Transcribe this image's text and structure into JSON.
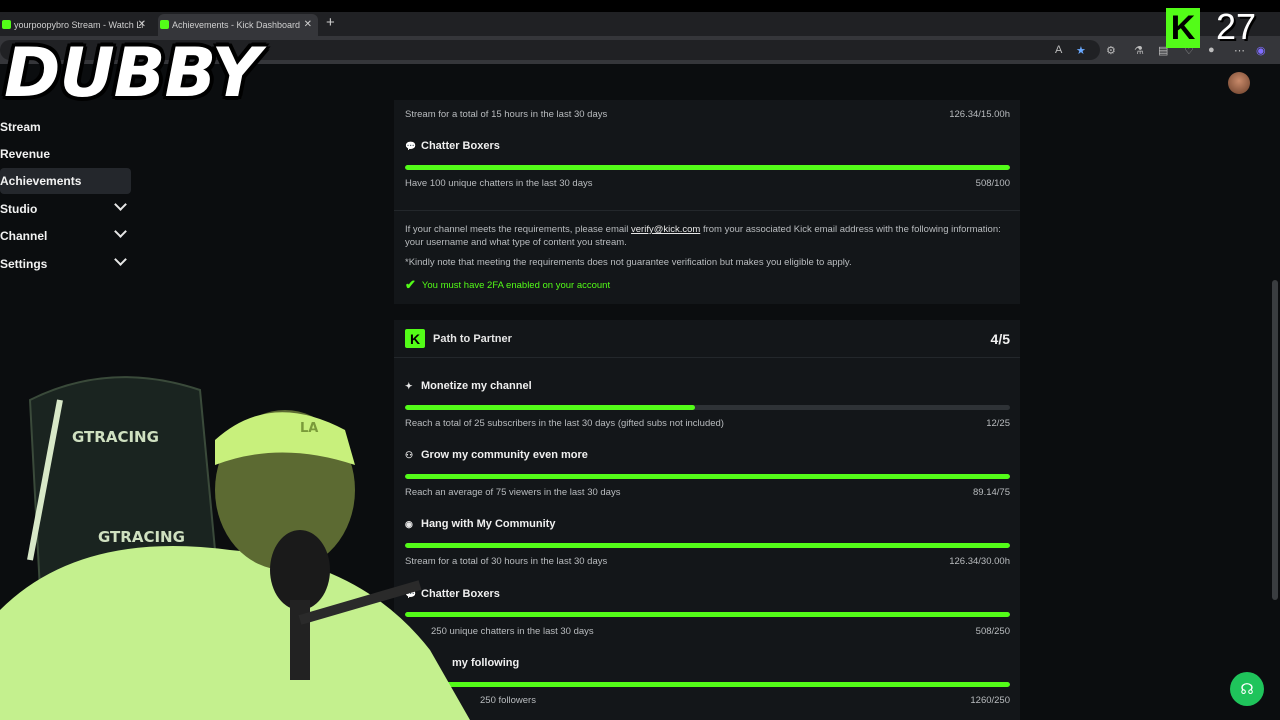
{
  "browser": {
    "tabs": [
      {
        "title": "yourpoopybro Stream - Watch Li"
      },
      {
        "title": "Achievements - Kick Dashboard"
      }
    ],
    "new_tab": "+"
  },
  "overlay": {
    "streamer_name": "DUBBY",
    "viewer_count": "27",
    "kick_badge": "K",
    "chair_brand": "GTRACING",
    "hat_logo": "LA"
  },
  "sidebar": {
    "items": [
      {
        "label": "Stream"
      },
      {
        "label": "Revenue"
      },
      {
        "label": "Achievements"
      },
      {
        "label": "Studio"
      },
      {
        "label": "Channel"
      },
      {
        "label": "Settings"
      }
    ]
  },
  "verified": {
    "items": [
      {
        "desc": "Stream for a total of 15 hours in the last 30 days",
        "value": "126.34/15.00h"
      },
      {
        "title": "Chatter Boxers",
        "desc": "Have 100 unique chatters in the last 30 days",
        "value": "508/100",
        "progress": 1.0
      }
    ],
    "info_prefix": "If your channel meets the requirements, please email ",
    "info_email": "verify@kick.com",
    "info_suffix": " from your associated Kick email address with the following information: your username and what type of content you stream.",
    "note": "*Kindly note that meeting the requirements does not guarantee verification but makes you eligible to apply.",
    "twofa": "You must have 2FA enabled on your account"
  },
  "partner": {
    "title": "Path to Partner",
    "count": "4/5",
    "logo": "K",
    "items": [
      {
        "title": "Monetize my channel",
        "desc": "Reach a total of 25 subscribers in the last 30 days (gifted subs not included)",
        "value": "12/25",
        "progress": 0.48
      },
      {
        "title": "Grow my community even more",
        "desc": "Reach an average of 75 viewers in the last 30 days",
        "value": "89.14/75",
        "progress": 1.0
      },
      {
        "title": "Hang with My Community",
        "desc": "Stream for a total of 30 hours in the last 30 days",
        "value": "126.34/30.00h",
        "progress": 1.0
      },
      {
        "title": "Chatter Boxers",
        "desc": "250 unique chatters in the last 30 days",
        "value": "508/250",
        "progress": 1.0
      },
      {
        "title": "my following",
        "desc": "250 followers",
        "value": "1260/250",
        "progress": 1.0
      }
    ]
  },
  "colors": {
    "accent": "#53fc18",
    "panel": "#131619",
    "background": "#0b0d0f"
  }
}
